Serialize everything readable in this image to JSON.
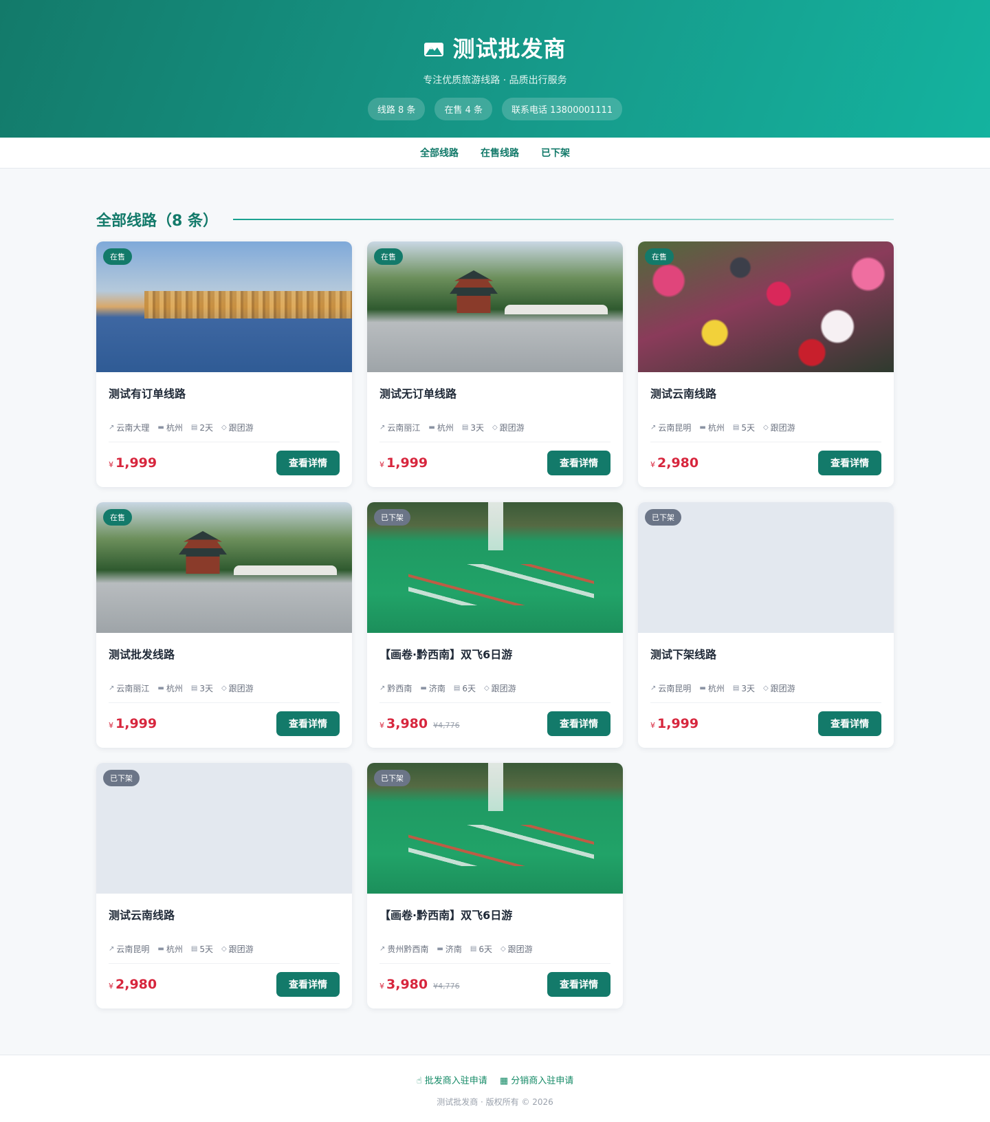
{
  "header": {
    "title": "测试批发商",
    "subtitle": "专注优质旅游线路 · 品质出行服务",
    "badges": [
      "线路 8 条",
      "在售 4 条",
      "联系电话 13800001111"
    ]
  },
  "nav": [
    "全部线路",
    "在售线路",
    "已下架"
  ],
  "section": {
    "title": "全部线路（8 条）"
  },
  "common": {
    "detail_label": "查看详情",
    "yen": "¥"
  },
  "cards": [
    {
      "status": "在售",
      "title": "测试有订单线路",
      "destination": "云南大理",
      "departure": "杭州",
      "days": "2天",
      "type": "跟团游",
      "price": "1,999",
      "old_price": "",
      "image": "lake"
    },
    {
      "status": "在售",
      "title": "测试无订单线路",
      "destination": "云南丽江",
      "departure": "杭州",
      "days": "3天",
      "type": "跟团游",
      "price": "1,999",
      "old_price": "",
      "image": "pagoda"
    },
    {
      "status": "在售",
      "title": "测试云南线路",
      "destination": "云南昆明",
      "departure": "杭州",
      "days": "5天",
      "type": "跟团游",
      "price": "2,980",
      "old_price": "",
      "image": "flowers"
    },
    {
      "status": "在售",
      "title": "测试批发线路",
      "destination": "云南丽江",
      "departure": "杭州",
      "days": "3天",
      "type": "跟团游",
      "price": "1,999",
      "old_price": "",
      "image": "pagoda"
    },
    {
      "status": "已下架",
      "title": "【画卷·黔西南】双飞6日游",
      "destination": "黔西南",
      "departure": "济南",
      "days": "6天",
      "type": "跟团游",
      "price": "3,980",
      "old_price": "¥4,776",
      "image": "kayak"
    },
    {
      "status": "已下架",
      "title": "测试下架线路",
      "destination": "云南昆明",
      "departure": "杭州",
      "days": "3天",
      "type": "跟团游",
      "price": "1,999",
      "old_price": "",
      "image": "empty"
    },
    {
      "status": "已下架",
      "title": "测试云南线路",
      "destination": "云南昆明",
      "departure": "杭州",
      "days": "5天",
      "type": "跟团游",
      "price": "2,980",
      "old_price": "",
      "image": "empty"
    },
    {
      "status": "已下架",
      "title": "【画卷·黔西南】双飞6日游",
      "destination": "贵州黔西南",
      "departure": "济南",
      "days": "6天",
      "type": "跟团游",
      "price": "3,980",
      "old_price": "¥4,776",
      "image": "kayak"
    }
  ],
  "footer": {
    "links": [
      "批发商入驻申请",
      "分销商入驻申请"
    ],
    "copyright": "测试批发商 · 版权所有 © 2026"
  },
  "colors": {
    "primary": "#137a6a",
    "price": "#d7263d",
    "off_badge": "#6b7587"
  }
}
